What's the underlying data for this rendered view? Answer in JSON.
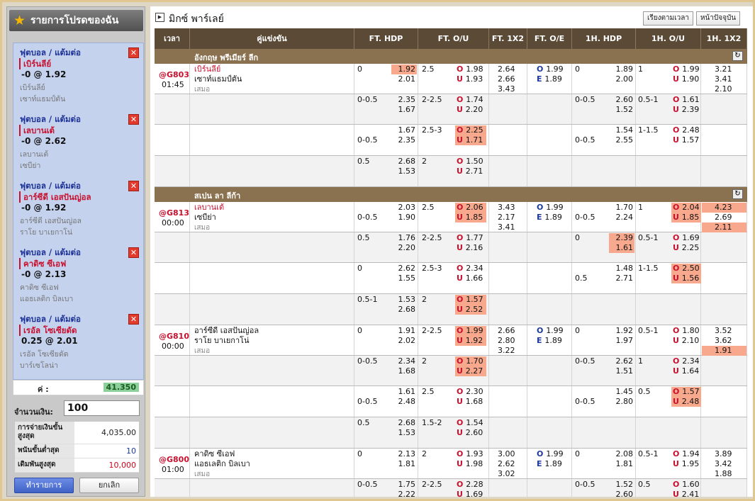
{
  "sidebar": {
    "title": "รายการโปรดของฉัน",
    "bets": [
      {
        "type": "ฟุตบอล / แต้มต่อ",
        "pick": "เบิร์นลีย์",
        "line": "-0 @ 1.92",
        "team1": "เบิร์นลีย์",
        "team2": "เซาท์แธมป์ตัน"
      },
      {
        "type": "ฟุตบอล / แต้มต่อ",
        "pick": "เลบานเต้",
        "line": "-0 @ 2.62",
        "team1": "เลบานเต้",
        "team2": "เซบีย่า"
      },
      {
        "type": "ฟุตบอล / แต้มต่อ",
        "pick": "อาร์ซีดี เอสปันญ่อล",
        "line": "-0 @ 1.92",
        "team1": "อาร์ซีดี เอสปันญ่อล",
        "team2": "ราโย บาเยกาโน่"
      },
      {
        "type": "ฟุตบอล / แต้มต่อ",
        "pick": "คาดิซ ซีเอฟ",
        "line": "-0 @ 2.13",
        "team1": "คาดิซ ซีเอฟ",
        "team2": "แอธเลติก บิลเบา"
      },
      {
        "type": "ฟุตบอล / แต้มต่อ",
        "pick": "เรอัล โซเซียดัด",
        "line": "0.25 @ 2.01",
        "team1": "เรอัล โซเซียดัด",
        "team2": "บาร์เซโลน่า"
      }
    ],
    "odds_label": "ค่ :",
    "odds_value": "41.350",
    "amount_label": "จำนวนเงิน:",
    "amount_value": "100",
    "max_payout_label": "การจ่ายเงินขั้นสูงสุด",
    "max_payout_value": "4,035.00",
    "min_bet_label": "พนันขั้นต่ำสุด",
    "min_bet_value": "10",
    "max_bet_label": "เดิมพันสูงสุด",
    "max_bet_value": "10,000",
    "submit_label": "ทำรายการ",
    "cancel_label": "ยกเลิก"
  },
  "main": {
    "title": "มิกซ์ พาร์เลย์",
    "sort_label": "เรียงตามเวลา",
    "now_label": "หน้าปัจจุบัน",
    "columns": [
      "เวลา",
      "คู่แข่งขัน",
      "FT. HDP",
      "FT. O/U",
      "FT. 1X2",
      "FT. O/E",
      "1H. HDP",
      "1H. O/U",
      "1H. 1X2"
    ],
    "leagues": [
      {
        "name": "อังกฤษ พรีเมียร์ ลีก"
      },
      {
        "name": "สเปน ลา ลีก้า"
      }
    ],
    "matches": [
      {
        "id": "@G803",
        "time": "01:45",
        "home": "เบิร์นลีย์",
        "away": "เซาท์แธมป์ตัน",
        "draw": "เสมอ",
        "rows": [
          {
            "hdp": "0",
            "hdp_h": "1.92",
            "hdp_a": "2.01",
            "ou": "2.5",
            "ou_o": "1.98",
            "ou_u": "1.93",
            "x1": "2.64",
            "x2": "2.66",
            "x3": "3.43",
            "oe_o": "1.99",
            "oe_e": "1.89",
            "h1hdp": "0",
            "h1_h": "1.89",
            "h1_a": "2.00",
            "h1ou": "1",
            "h1_o": "1.99",
            "h1_u": "1.90",
            "h1x1": "3.21",
            "h1x2": "3.41",
            "h1x3": "2.10"
          },
          {
            "hdp": "0-0.5",
            "hdp_h": "2.35",
            "hdp_a": "1.67",
            "ou": "2-2.5",
            "ou_o": "1.74",
            "ou_u": "2.20",
            "h1hdp": "0-0.5",
            "h1_h": "2.60",
            "h1_a": "1.52",
            "h1ou": "0.5-1",
            "h1_o": "1.61",
            "h1_u": "2.39"
          },
          {
            "hdp": "0-0.5",
            "hdp_h": "1.67",
            "hdp_a": "2.35",
            "ou": "2.5-3",
            "ou_o": "2.25",
            "ou_u": "1.71",
            "h1hdp": "0-0.5",
            "h1_h": "1.54",
            "h1_a": "2.55",
            "h1ou": "1-1.5",
            "h1_o": "2.48",
            "h1_u": "1.57"
          },
          {
            "hdp": "0.5",
            "hdp_h": "2.68",
            "hdp_a": "1.53",
            "ou": "2",
            "ou_o": "1.50",
            "ou_u": "2.71"
          }
        ]
      },
      {
        "id": "@G813",
        "time": "00:00",
        "home": "เลบานเต้",
        "away": "เซบีย่า",
        "draw": "เสมอ",
        "rows": [
          {
            "hdp": "0-0.5",
            "hdp_h": "2.03",
            "hdp_a": "1.90",
            "ou": "2.5",
            "ou_o": "2.06",
            "ou_u": "1.85",
            "x1": "3.43",
            "x2": "2.17",
            "x3": "3.41",
            "oe_o": "1.99",
            "oe_e": "1.89",
            "h1hdp": "0-0.5",
            "h1_h": "1.70",
            "h1_a": "2.24",
            "h1ou": "1",
            "h1_o": "2.04",
            "h1_u": "1.85",
            "h1x1": "4.23",
            "h1x2": "2.69",
            "h1x3": "2.11"
          },
          {
            "hdp": "0.5",
            "hdp_h": "1.76",
            "hdp_a": "2.20",
            "ou": "2-2.5",
            "ou_o": "1.77",
            "ou_u": "2.16",
            "h1hdp": "0",
            "h1_h": "2.39",
            "h1_a": "1.61",
            "h1ou": "0.5-1",
            "h1_o": "1.69",
            "h1_u": "2.25"
          },
          {
            "hdp": "0",
            "hdp_h": "2.62",
            "hdp_a": "1.55",
            "ou": "2.5-3",
            "ou_o": "2.34",
            "ou_u": "1.66",
            "h1hdp": "0.5",
            "h1_h": "1.48",
            "h1_a": "2.71",
            "h1ou": "1-1.5",
            "h1_o": "2.50",
            "h1_u": "1.56"
          },
          {
            "hdp": "0.5-1",
            "hdp_h": "1.53",
            "hdp_a": "2.68",
            "ou": "2",
            "ou_o": "1.57",
            "ou_u": "2.52"
          }
        ]
      },
      {
        "id": "@G810",
        "time": "00:00",
        "home": "อาร์ซีดี เอสปันญ่อล",
        "away": "ราโย บาเยกาโน่",
        "draw": "เสมอ",
        "rows": [
          {
            "hdp": "0",
            "hdp_h": "1.91",
            "hdp_a": "2.02",
            "ou": "2-2.5",
            "ou_o": "1.99",
            "ou_u": "1.92",
            "x1": "2.66",
            "x2": "2.80",
            "x3": "3.22",
            "oe_o": "1.99",
            "oe_e": "1.89",
            "h1hdp": "0",
            "h1_h": "1.92",
            "h1_a": "1.97",
            "h1ou": "0.5-1",
            "h1_o": "1.80",
            "h1_u": "2.10",
            "h1x1": "3.52",
            "h1x2": "3.62",
            "h1x3": "1.91"
          },
          {
            "hdp": "0-0.5",
            "hdp_h": "2.34",
            "hdp_a": "1.68",
            "ou": "2",
            "ou_o": "1.70",
            "ou_u": "2.27",
            "h1hdp": "0-0.5",
            "h1_h": "2.62",
            "h1_a": "1.51",
            "h1ou": "1",
            "h1_o": "2.34",
            "h1_u": "1.64"
          },
          {
            "hdp": "0-0.5",
            "hdp_h": "1.61",
            "hdp_a": "2.48",
            "ou": "2.5",
            "ou_o": "2.30",
            "ou_u": "1.68",
            "h1hdp": "0-0.5",
            "h1_h": "1.45",
            "h1_a": "2.80",
            "h1ou": "0.5",
            "h1_o": "1.57",
            "h1_u": "2.48"
          },
          {
            "hdp": "0.5",
            "hdp_h": "2.68",
            "hdp_a": "1.53",
            "ou": "1.5-2",
            "ou_o": "1.54",
            "ou_u": "2.60"
          }
        ]
      },
      {
        "id": "@G800",
        "time": "01:00",
        "home": "คาดิซ ซีเอฟ",
        "away": "แอธเลติก บิลเบา",
        "draw": "เสมอ",
        "rows": [
          {
            "hdp": "0",
            "hdp_h": "2.13",
            "hdp_a": "1.81",
            "ou": "2",
            "ou_o": "1.93",
            "ou_u": "1.98",
            "x1": "3.00",
            "x2": "2.62",
            "x3": "3.02",
            "oe_o": "1.99",
            "oe_e": "1.89",
            "h1hdp": "0",
            "h1_h": "2.08",
            "h1_a": "1.81",
            "h1ou": "0.5-1",
            "h1_o": "1.94",
            "h1_u": "1.95",
            "h1x1": "3.89",
            "h1x2": "3.42",
            "h1x3": "1.88"
          },
          {
            "hdp": "0-0.5",
            "hdp_h": "1.75",
            "hdp_a": "2.22",
            "ou": "2-2.5",
            "ou_o": "2.28",
            "ou_u": "1.69",
            "h1hdp": "0-0.5",
            "h1_h": "1.52",
            "h1_a": "2.60",
            "h1ou": "0.5",
            "h1_o": "1.60",
            "h1_u": "2.41"
          }
        ]
      }
    ],
    "labels": {
      "over": "O",
      "under": "U",
      "odd": "O",
      "even": "E"
    }
  },
  "colors": {
    "header_bg": "#5b4a36",
    "league_bg": "#8a7150",
    "highlight": "#f7a88d",
    "fav": "#c8102e"
  }
}
